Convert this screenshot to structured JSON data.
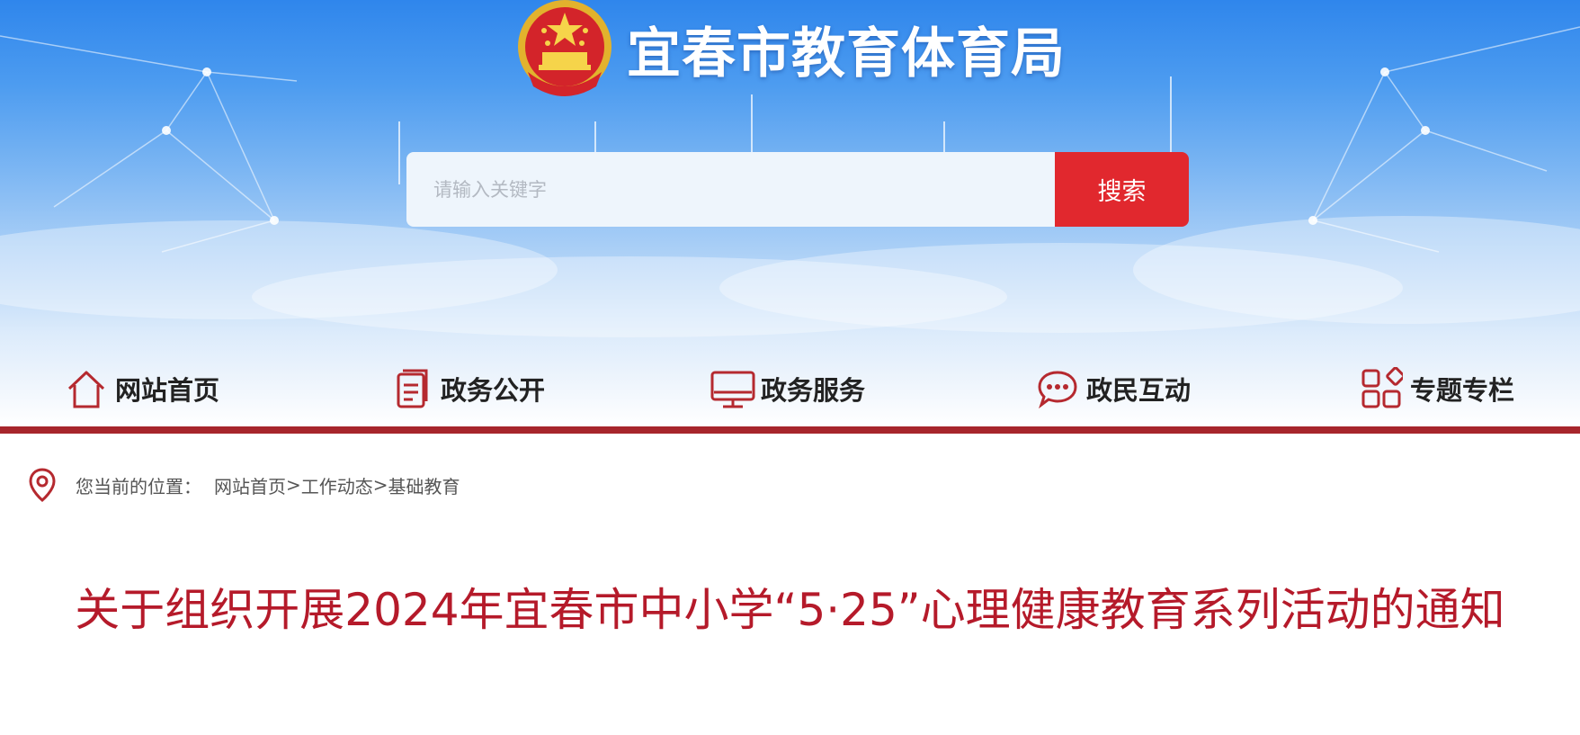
{
  "header": {
    "site_title": "宜春市教育体育局"
  },
  "search": {
    "placeholder": "请输入关键字",
    "value": "",
    "button_label": "搜索"
  },
  "nav": {
    "items": [
      {
        "label": "网站首页",
        "icon": "home-icon"
      },
      {
        "label": "政务公开",
        "icon": "document-icon"
      },
      {
        "label": "政务服务",
        "icon": "monitor-icon"
      },
      {
        "label": "政民互动",
        "icon": "chat-icon"
      },
      {
        "label": "专题专栏",
        "icon": "grid-icon"
      }
    ]
  },
  "breadcrumb": {
    "lead": "您当前的位置：",
    "items": [
      "网站首页",
      "工作动态",
      "基础教育"
    ],
    "separator": ">"
  },
  "article": {
    "title": "关于组织开展2024年宜春市中小学“5·25”心理健康教育系列活动的通知"
  },
  "colors": {
    "accent_red": "#e1282e",
    "title_red": "#b51a2a",
    "bar_red": "#a7262c",
    "banner_blue": "#2f86ec"
  }
}
